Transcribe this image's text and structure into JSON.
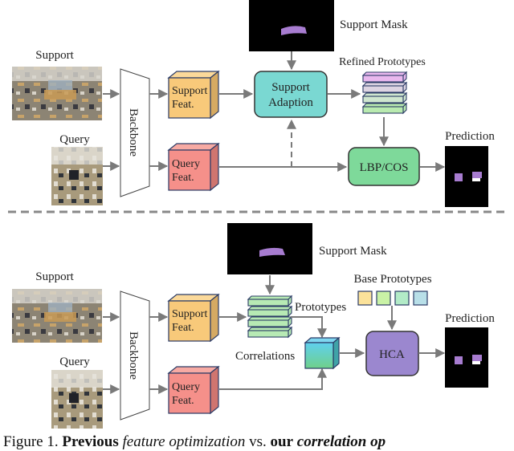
{
  "top_panel": {
    "support_label": "Support",
    "query_label": "Query",
    "backbone_label": "Backbone",
    "support_feat_label": [
      "Support",
      "Feat."
    ],
    "query_feat_label": [
      "Query",
      "Feat."
    ],
    "support_mask_label": "Support Mask",
    "support_adaption_label": [
      "Support",
      "Adaption"
    ],
    "refined_prototypes_label": "Refined Prototypes",
    "refined_prototype_colors": [
      "#e9b8ee",
      "#ddd4e2",
      "#cfe6cf",
      "#b9eab0"
    ],
    "lbp_cos_label": "LBP/COS",
    "prediction_label": "Prediction"
  },
  "bottom_panel": {
    "support_label": "Support",
    "query_label": "Query",
    "backbone_label": "Backbone",
    "support_feat_label": [
      "Support",
      "Feat."
    ],
    "query_feat_label": [
      "Query",
      "Feat."
    ],
    "support_mask_label": "Support Mask",
    "prototypes_label": "Prototypes",
    "prototype_colors": [
      "#b7eab4",
      "#b7eab4",
      "#b7eab4",
      "#b7eab4"
    ],
    "base_prototypes_label": "Base Prototypes",
    "base_prototype_colors": [
      "#fbe29a",
      "#c9f2a6",
      "#b2ebc7",
      "#b8dfe8"
    ],
    "correlations_label": "Correlations",
    "hca_label": "HCA",
    "prediction_label": "Prediction"
  },
  "colors": {
    "support_feat": "#f8c97a",
    "query_feat": "#f5908a",
    "support_adaption": "#7ad8d2",
    "lbp_cos": "#7ed99a",
    "hca": "#9b87cf",
    "mask_object": "#a77cd0",
    "arrow": "#7a7a7a"
  },
  "caption": {
    "prefix": "Figure 1.",
    "bold1": "Previous",
    "italic1": "feature optimization",
    "vs": "vs.",
    "bold2": "our",
    "italic2": "correlation op"
  }
}
